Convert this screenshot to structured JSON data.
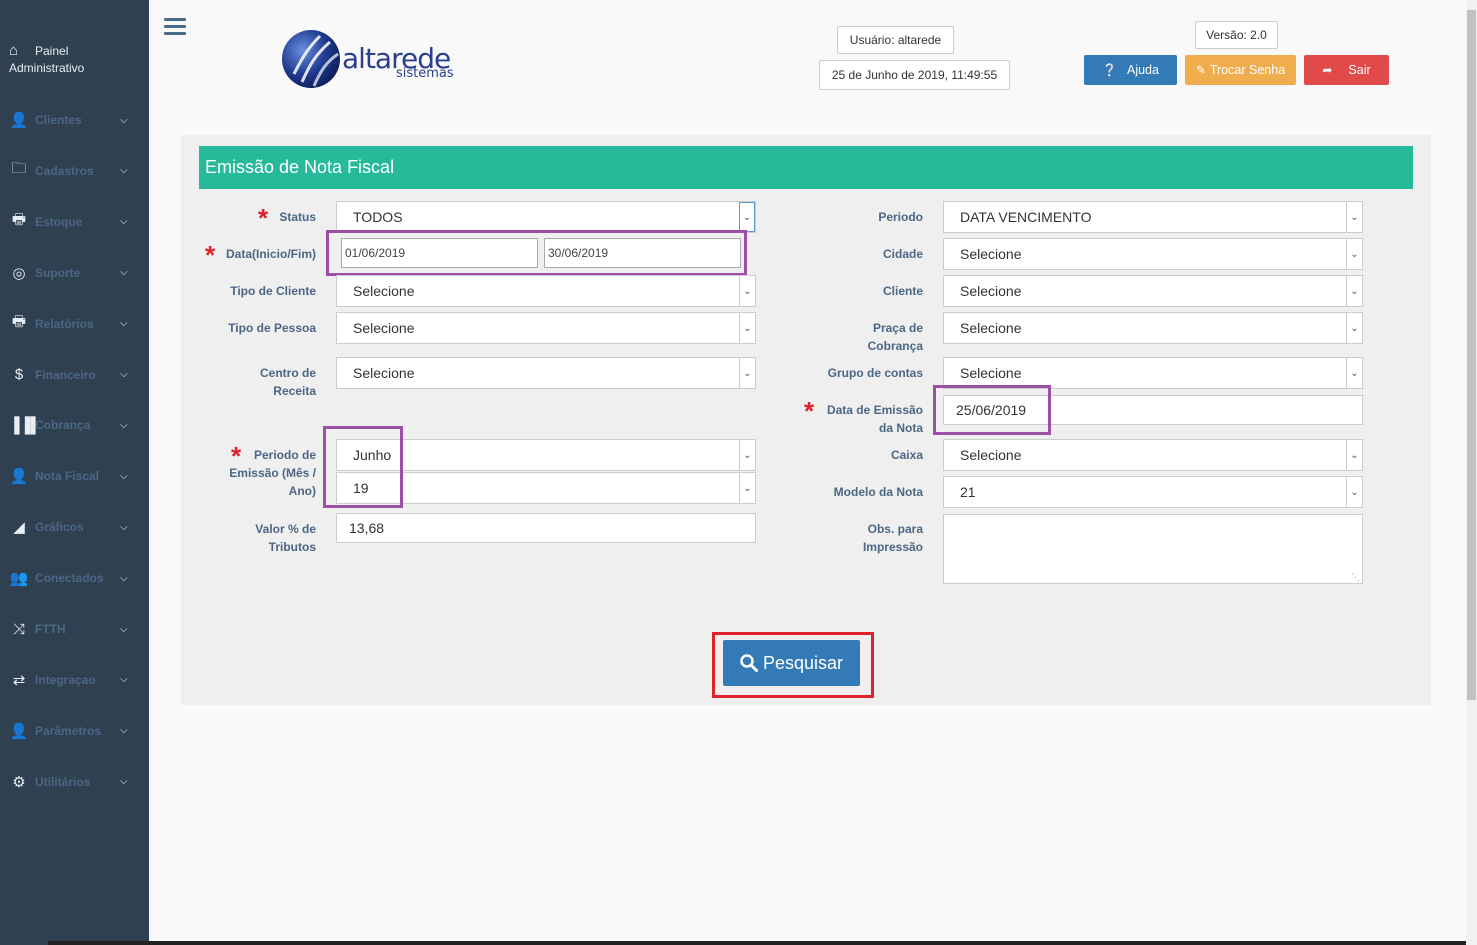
{
  "sidebar": {
    "home_line1": "Painel",
    "home_line2": "Administrativo",
    "items": [
      {
        "label": "Clientes",
        "icon": "user-icon"
      },
      {
        "label": "Cadastros",
        "icon": "folder-icon"
      },
      {
        "label": "Estoque",
        "icon": "print-icon"
      },
      {
        "label": "Suporte",
        "icon": "lifebuoy-icon"
      },
      {
        "label": "Relatórios",
        "icon": "print-icon"
      },
      {
        "label": "Financeiro",
        "icon": "dollar-icon"
      },
      {
        "label": "Cobrança",
        "icon": "barcode-icon"
      },
      {
        "label": "Nota Fiscal",
        "icon": "user-icon"
      },
      {
        "label": "Gráficos",
        "icon": "area-chart-icon"
      },
      {
        "label": "Conectados",
        "icon": "users-icon"
      },
      {
        "label": "FTTH",
        "icon": "random-icon"
      },
      {
        "label": "Integraçao",
        "icon": "retweet-icon"
      },
      {
        "label": "Parâmetros",
        "icon": "user-icon"
      },
      {
        "label": "Utilitários",
        "icon": "cogs-icon"
      }
    ]
  },
  "header": {
    "logo_text": "altarede",
    "logo_sub": "sistemas",
    "user": "Usuário: altarede",
    "datetime": "25 de Junho de 2019, 11:49:55",
    "version": "Versão: 2.0",
    "help_label": "Ajuda",
    "change_password_label": "Trocar Senha",
    "exit_label": "Sair"
  },
  "form": {
    "title": "Emissão de Nota Fiscal",
    "required_mark": "*",
    "status_label": "Status",
    "status_value": "TODOS",
    "date_label": "Data(Inicio/Fim)",
    "date_start": "01/06/2019",
    "date_end": "30/06/2019",
    "client_type_label": "Tipo de Cliente",
    "client_type_value": "Selecione",
    "person_type_label": "Tipo de Pessoa",
    "person_type_value": "Selecione",
    "revenue_center_label_1": "Centro de",
    "revenue_center_label_2": "Receita",
    "revenue_center_value": "Selecione",
    "emission_period_label_1": "Periodo de",
    "emission_period_label_2": "Emissão (Mês /",
    "emission_period_label_3": "Ano)",
    "emission_month": "Junho",
    "emission_year": "19",
    "tax_label_1": "Valor % de",
    "tax_label_2": "Tributos",
    "tax_value": "13,68",
    "period_label": "Periodo",
    "period_value": "DATA VENCIMENTO",
    "city_label": "Cidade",
    "city_value": "Selecione",
    "client_label": "Cliente",
    "client_value": "Selecione",
    "collection_label_1": "Praça de",
    "collection_label_2": "Cobrança",
    "collection_value": "Selecione",
    "account_group_label": "Grupo de contas",
    "account_group_value": "Selecione",
    "note_date_label_1": "Data de Emissão",
    "note_date_label_2": "da Nota",
    "note_date_value": "25/06/2019",
    "cashier_label": "Caixa",
    "cashier_value": "Selecione",
    "note_model_label": "Modelo da Nota",
    "note_model_value": "21",
    "obs_label_1": "Obs. para",
    "obs_label_2": "Impressão",
    "search_label": "Pesquisar"
  },
  "colors": {
    "sidebar": "#2f4050",
    "panel_header": "#26b99a",
    "primary": "#337ab7",
    "warning": "#f0ad4e",
    "danger": "#e04a4a",
    "highlight_purple": "#9b4fa5",
    "highlight_red": "#e0202a"
  }
}
